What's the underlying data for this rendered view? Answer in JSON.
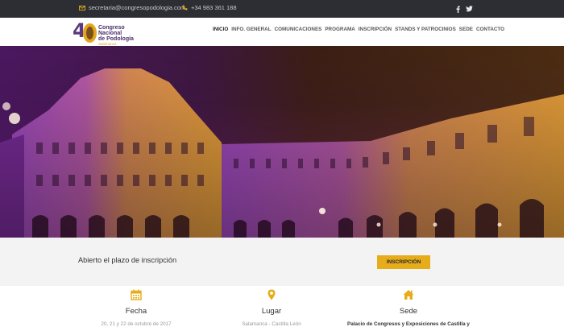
{
  "topbar": {
    "email": "secretaria@congresopodologia.com",
    "phone": "+34 983 361 188",
    "social": [
      "facebook-icon",
      "twitter-icon"
    ]
  },
  "logo": {
    "number": "4",
    "line1": "Congreso",
    "line2": "Nacional",
    "line3": "de Podología",
    "city": "Salamanca"
  },
  "nav": {
    "items": [
      "Inicio",
      "Info. General",
      "Comunicaciones",
      "Programa",
      "Inscripción",
      "Stands y patrocinios",
      "Sede",
      "Contacto"
    ],
    "active": "Inicio"
  },
  "banner": {
    "message": "Abierto el plazo de inscripción",
    "button": "Inscripción"
  },
  "info": [
    {
      "icon": "calendar-icon",
      "title": "Fecha",
      "detail": "20, 21 y 22 de octubre de 2017"
    },
    {
      "icon": "map-pin-icon",
      "title": "Lugar",
      "detail": "Salamanca - Castilla León"
    },
    {
      "icon": "home-icon",
      "title": "Sede",
      "detail": "Palacio de Congresos y Exposiciones de Castilla y"
    }
  ],
  "colors": {
    "accent": "#e7ac1a",
    "brand_purple": "#5a3a7a",
    "topbar": "#2c2e34"
  }
}
